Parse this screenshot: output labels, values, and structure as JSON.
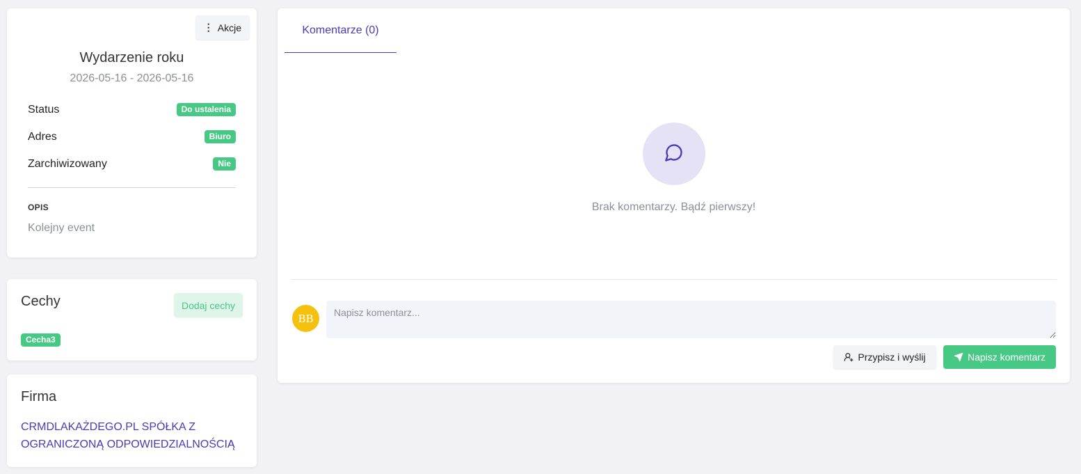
{
  "event": {
    "actions_label": "Akcje",
    "title": "Wydarzenie roku",
    "dates": "2026-05-16 - 2026-05-16",
    "fields": [
      {
        "label": "Status",
        "value": "Do ustalenia"
      },
      {
        "label": "Adres",
        "value": "Biuro"
      },
      {
        "label": "Zarchiwizowany",
        "value": "Nie"
      }
    ],
    "description_label": "OPIS",
    "description": "Kolejny event"
  },
  "features": {
    "title": "Cechy",
    "add_label": "Dodaj cechy",
    "items": [
      "Cecha3"
    ]
  },
  "company": {
    "title": "Firma",
    "name": "CRMDLAKAŻDEGO.PL SPÓŁKA Z OGRANICZONĄ ODPOWIEDZIALNOŚCIĄ"
  },
  "comments": {
    "tab_label": "Komentarze (0)",
    "empty_text": "Brak komentarzy. Bądź pierwszy!",
    "avatar_initials": "BB",
    "input_placeholder": "Napisz komentarz...",
    "input_value": "",
    "assign_label": "Przypisz i wyślij",
    "send_label": "Napisz komentarz"
  },
  "colors": {
    "accent": "#4a3ab5",
    "success": "#47c985",
    "avatar": "#f5c00e",
    "background": "#f2f2f6"
  },
  "icons": {
    "actions": "kebab-vertical-icon",
    "empty_comments": "chat-bubble-icon",
    "assign": "user-plus-icon",
    "send": "send-icon"
  }
}
